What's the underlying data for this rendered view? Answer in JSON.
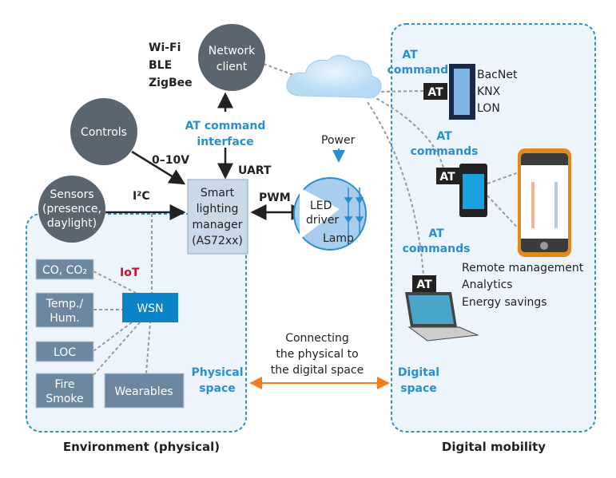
{
  "colors": {
    "accent_blue": "#2a8fd0",
    "wsn": "#0a84c6",
    "sensor_box": "#6d87a0",
    "circle": "#5b6570",
    "iot": "#c8102e",
    "arrow_orange": "#f07c1e",
    "phone_frame": "#e08a1e"
  },
  "nodes": {
    "network_client": [
      "Network",
      "client"
    ],
    "protocols": [
      "Wi-Fi",
      "BLE",
      "ZigBee"
    ],
    "controls": "Controls",
    "sensors": [
      "Sensors",
      "(presence,",
      "daylight)"
    ],
    "manager": [
      "Smart",
      "lighting",
      "manager",
      "(AS72xx)"
    ],
    "lamp": {
      "driver": [
        "LED",
        "driver"
      ],
      "lamp": "Lamp"
    },
    "power": "Power"
  },
  "links": {
    "at_interface": [
      "AT command",
      "interface"
    ],
    "uart": "UART",
    "analog": "0–10V",
    "i2c": "I²C",
    "pwm": "PWM"
  },
  "iot": {
    "label": "IoT",
    "wsn": "WSN",
    "sensors": {
      "co": "CO, CO₂",
      "temp": [
        "Temp./",
        "Hum."
      ],
      "loc": "LOC",
      "fire": [
        "Fire",
        "Smoke"
      ],
      "wearables": "Wearables"
    }
  },
  "middle": {
    "connecting": [
      "Connecting",
      "the physical to",
      "the digital space"
    ],
    "physical_space": [
      "Physical",
      "space"
    ],
    "digital_space": [
      "Digital",
      "space"
    ]
  },
  "digital": {
    "at_badge": "AT",
    "at_commands": [
      "AT",
      "commands"
    ],
    "building_protocols": [
      "BacNet",
      "KNX",
      "LON"
    ],
    "features": [
      "Remote management",
      "Analytics",
      "Energy savings"
    ]
  },
  "regions": {
    "physical": "Environment (physical)",
    "digital": "Digital mobility"
  }
}
